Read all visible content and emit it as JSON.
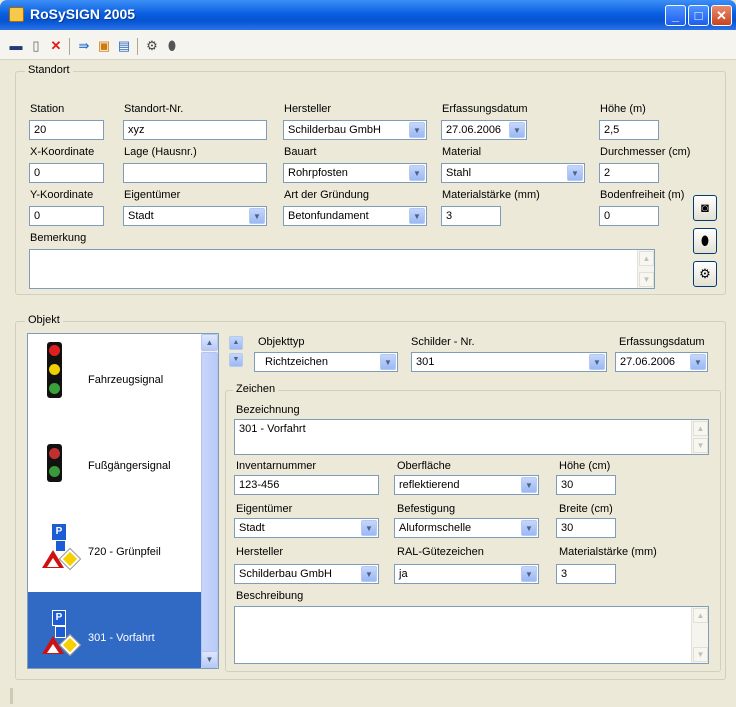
{
  "app": {
    "title": "RoSySIGN 2005"
  },
  "window_buttons": {
    "minimize": "_",
    "maximize": "□",
    "close": "✕"
  },
  "toolbar": [
    {
      "icon": "save-icon",
      "glyph": "▬"
    },
    {
      "icon": "new-icon",
      "glyph": "▯"
    },
    {
      "icon": "delete-icon",
      "glyph": "✕"
    },
    {
      "icon": "import-icon",
      "glyph": "⇛"
    },
    {
      "icon": "export-icon",
      "glyph": "▣"
    },
    {
      "icon": "report-icon",
      "glyph": "▤"
    },
    {
      "icon": "settings-icon",
      "glyph": "⚙"
    },
    {
      "icon": "bulb-icon",
      "glyph": "⬮"
    }
  ],
  "standort": {
    "legend": "Standort",
    "station_label": "Station",
    "station_value": "20",
    "nr_label": "Standort-Nr.",
    "nr_value": "xyz",
    "hersteller_label": "Hersteller",
    "hersteller_value": "Schilderbau GmbH",
    "datum_label": "Erfassungsdatum",
    "datum_value": "27.06.2006",
    "hoehe_label": "Höhe (m)",
    "hoehe_value": "2,5",
    "x_label": "X-Koordinate",
    "x_value": "0",
    "lage_label": "Lage (Hausnr.)",
    "lage_value": "",
    "bauart_label": "Bauart",
    "bauart_value": "Rohrpfosten",
    "material_label": "Material",
    "material_value": "Stahl",
    "durchmesser_label": "Durchmesser (cm)",
    "durchmesser_value": "2",
    "y_label": "Y-Koordinate",
    "y_value": "0",
    "eigentuemer_label": "Eigentümer",
    "eigentuemer_value": "Stadt",
    "gruendung_label": "Art der Gründung",
    "gruendung_value": "Betonfundament",
    "staerke_label": "Materialstärke (mm)",
    "staerke_value": "3",
    "boden_label": "Bodenfreiheit (m)",
    "boden_value": "0",
    "bemerkung_label": "Bemerkung",
    "bemerkung_value": ""
  },
  "objekt": {
    "legend": "Objekt",
    "list": [
      {
        "label": "Fahrzeugsignal",
        "icon": "traffic-light-icon"
      },
      {
        "label": "Fußgängersignal",
        "icon": "pedestrian-signal-icon"
      },
      {
        "label": "720 - Grünpfeil",
        "icon": "sign-stack-icon"
      },
      {
        "label": "301 - Vorfahrt",
        "icon": "sign-stack-icon"
      }
    ],
    "objekttyp_label": "Objekttyp",
    "objekttyp_value": "Richtzeichen",
    "schilder_label": "Schilder - Nr.",
    "schilder_value": "301",
    "datum_label": "Erfassungsdatum",
    "datum_value": "27.06.2006"
  },
  "zeichen": {
    "legend": "Zeichen",
    "bezeichnung_label": "Bezeichnung",
    "bezeichnung_value": "301 - Vorfahrt",
    "inventar_label": "Inventarnummer",
    "inventar_value": "123-456",
    "oberflaeche_label": "Oberfläche",
    "oberflaeche_value": "reflektierend",
    "hoehe_label": "Höhe (cm)",
    "hoehe_value": "30",
    "eigentuemer_label": "Eigentümer",
    "eigentuemer_value": "Stadt",
    "befestigung_label": "Befestigung",
    "befestigung_value": "Aluformschelle",
    "breite_label": "Breite (cm)",
    "breite_value": "30",
    "hersteller_label": "Hersteller",
    "hersteller_value": "Schilderbau GmbH",
    "ral_label": "RAL-Gütezeichen",
    "ral_value": "ja",
    "staerke_label": "Materialstärke (mm)",
    "staerke_value": "3",
    "beschreibung_label": "Beschreibung",
    "beschreibung_value": ""
  }
}
